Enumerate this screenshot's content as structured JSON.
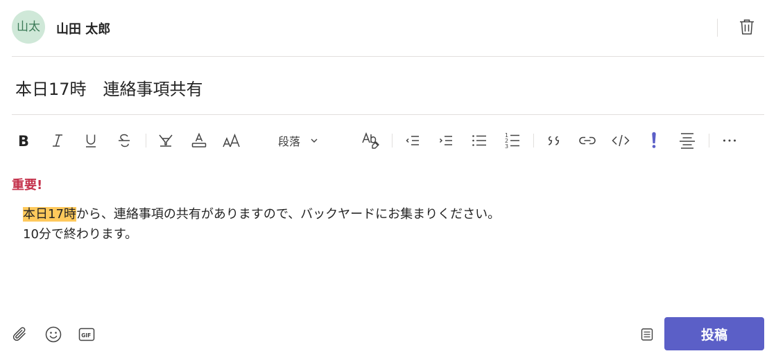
{
  "author": {
    "avatar_initials": "山太",
    "name": "山田 太郎"
  },
  "subject": "本日17時　連絡事項共有",
  "toolbar": {
    "paragraph_label": "段落",
    "buttons": [
      "bold-icon",
      "italic-icon",
      "underline-icon",
      "strikethrough-icon",
      "highlight-icon",
      "font-color-icon",
      "font-size-icon",
      "spell-check-icon",
      "decrease-indent-icon",
      "increase-indent-icon",
      "bullet-list-icon",
      "numbered-list-icon",
      "quote-icon",
      "link-icon",
      "code-icon",
      "important-icon",
      "align-icon",
      "more-icon"
    ]
  },
  "message": {
    "importance_label": "重要!",
    "highlighted": "本日17時",
    "line1_rest": "から、連絡事項の共有がありますので、バックヤードにお集まりください。",
    "line2": "10分で終わります。"
  },
  "actions": {
    "send_label": "投稿"
  },
  "colors": {
    "accent": "#5b5fc7",
    "importance": "#c4314b",
    "highlight": "#ffc95c",
    "avatar_bg": "#cfe8d8"
  }
}
